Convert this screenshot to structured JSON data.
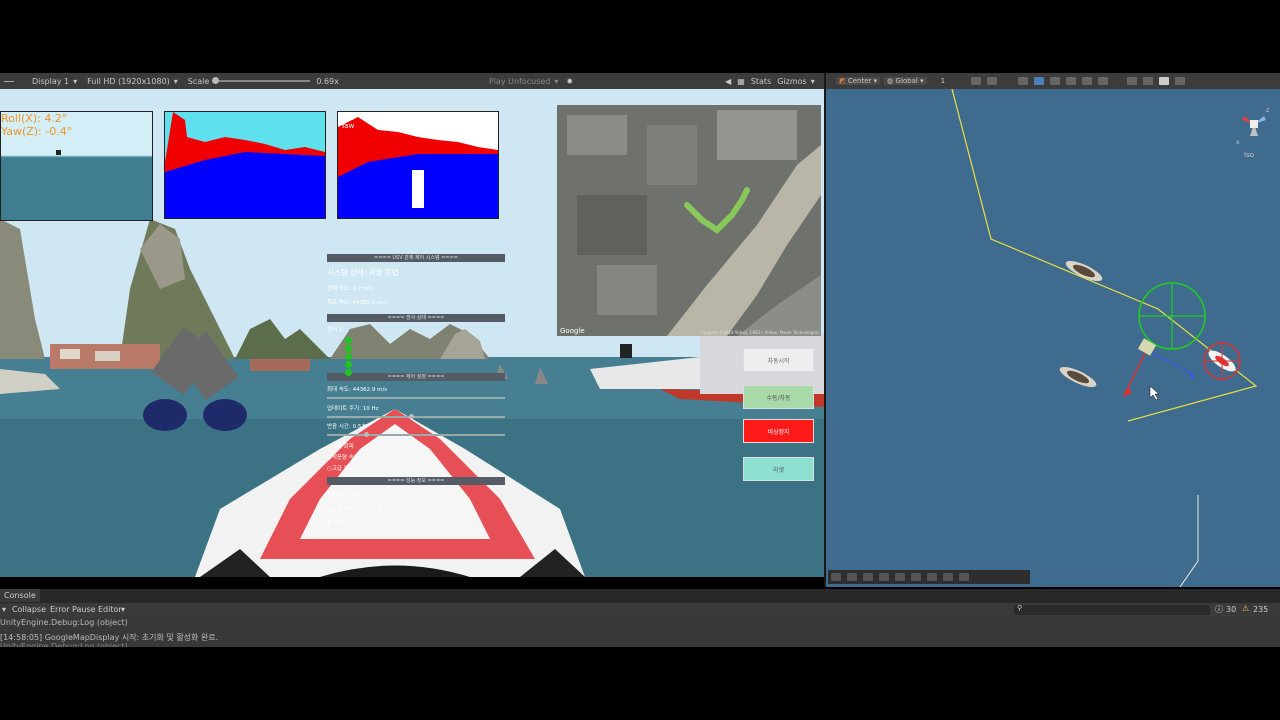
{
  "game_toolbar": {
    "display": "Display 1",
    "resolution": "Full HD (1920x1080)",
    "scale_label": "Scale",
    "scale_value": "0.69x",
    "play_mode": "Play Unfocused",
    "stats": "Stats",
    "gizmos": "Gizmos"
  },
  "overlay": {
    "roll": "Roll(X): 4.2°",
    "yaw": "Yaw(Z): -0.4°",
    "cam3_label1": "Roll",
    "cam3_label2": "Yaw"
  },
  "map": {
    "brand": "Google",
    "attribution": "Imagery ©2024 Airbus, CNES / Airbus, Maxar Technologies"
  },
  "control_panel": {
    "header1": "==== USV 관제 제어 시스템 ====",
    "system_status": "시스템 상태: 자율 항법",
    "current_speed": "현재 속도: 0.7 m/s",
    "target_speed": "목표 속도: 44362.9 m/s",
    "header2": "==== 센서 상태 ====",
    "sensor_label": "센서 1:",
    "header3": "==== 제어 설정 ====",
    "speed_set": "최대 속도: 44362.9 m/s",
    "update_rate": "업데이트 주기: 10 Hz",
    "response_time": "반응 시간: 0.5초",
    "radio1": "예측 회피",
    "radio2": "적응형 속도",
    "radio3": "고급 로깅",
    "header4": "==== 성능 정보 ====",
    "run_time": "운행 시간: 54초",
    "waypoints": "도달한 웨이포인트: 2개",
    "total_distance": "총 항해 거리: 10m"
  },
  "buttons": {
    "auto_start": "자동시작",
    "manual_auto": "수동/자동",
    "emergency_stop": "비상정지",
    "reset": "리셋"
  },
  "scene_toolbar": {
    "pivot": "Center",
    "space": "Global",
    "snap": "1"
  },
  "scene": {
    "iso": "Iso"
  },
  "console": {
    "tab": "Console",
    "collapse": "Collapse",
    "error_pause": "Error Pause",
    "editor": "Editor",
    "warnings": "30",
    "logs": "235",
    "line1": "UnityEngine.Debug:Log (object)",
    "line2": "[14:58:05] GoogleMapDisplay 시작: 초기화 및 활성화 완료.",
    "line3": "UnityEngine.Debug:Log (object)"
  },
  "colors": {
    "emergency": "#ff1a1a",
    "manual": "#a8d9a8",
    "reset": "#8de0d0",
    "auto": "#eeeeee",
    "sky_segment": "#5ee1ec",
    "obstacle_segment": "#f00000",
    "water_segment": "#0000ff"
  }
}
